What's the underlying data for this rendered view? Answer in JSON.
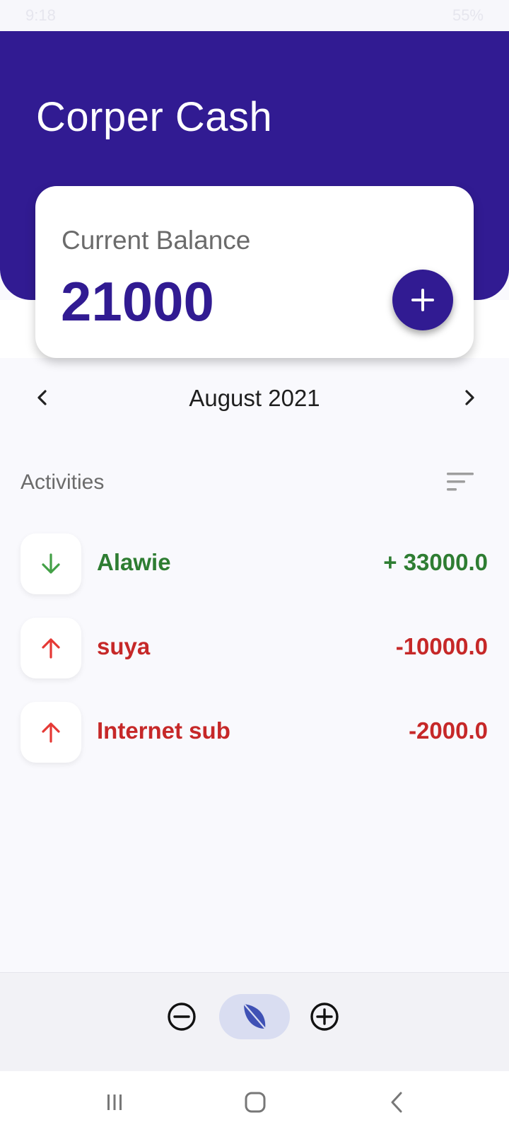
{
  "status_bar": {
    "time": "9:18",
    "battery": "55%"
  },
  "header": {
    "title": "Corper Cash"
  },
  "balance_card": {
    "label": "Current Balance",
    "value": "21000",
    "add_icon": "plus-icon"
  },
  "month_nav": {
    "label": "August 2021",
    "prev_icon": "chevron-left-icon",
    "next_icon": "chevron-right-icon"
  },
  "activities": {
    "title": "Activities",
    "sort_icon": "sort-icon",
    "items": [
      {
        "name": "Alawie",
        "amount": "+ 33000.0",
        "type": "income",
        "icon": "arrow-down-icon",
        "color": "#2e7d32"
      },
      {
        "name": "suya",
        "amount": "-10000.0",
        "type": "expense",
        "icon": "arrow-up-icon",
        "color": "#c62828"
      },
      {
        "name": "Internet sub",
        "amount": "-2000.0",
        "type": "expense",
        "icon": "arrow-up-icon",
        "color": "#c62828"
      }
    ]
  },
  "bottom_bar": {
    "items": [
      {
        "icon": "minus-circle-icon"
      },
      {
        "icon": "leaf-icon",
        "selected": true
      },
      {
        "icon": "plus-circle-icon"
      }
    ]
  },
  "colors": {
    "primary": "#311b92",
    "income": "#2e7d32",
    "expense": "#c62828",
    "selected_pill": "#d9ddf1"
  }
}
